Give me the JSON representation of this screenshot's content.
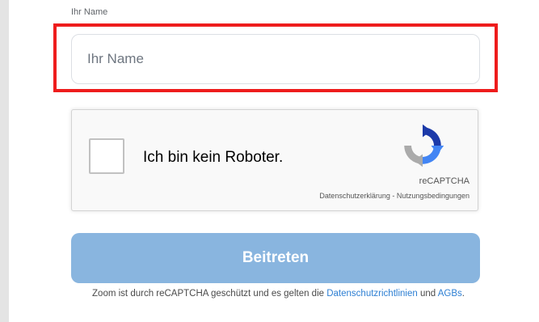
{
  "form": {
    "name_label": "Ihr Name",
    "name_input": {
      "value": "",
      "placeholder": "Ihr Name"
    },
    "highlight_color": "#ee1c1c"
  },
  "recaptcha": {
    "checkbox_label": "Ich bin kein Roboter.",
    "brand": "reCAPTCHA",
    "privacy_link": "Datenschutzerklärung",
    "separator": " - ",
    "terms_link": "Nutzungsbedingungen",
    "checked": false
  },
  "join_button": {
    "label": "Beitreten",
    "color": "#89b5df"
  },
  "footer": {
    "text_before": "Zoom ist durch reCAPTCHA geschützt und es gelten die ",
    "privacy_link": "Datenschutzrichtlinien",
    "text_middle": " und ",
    "terms_link": "AGBs",
    "text_end": ".",
    "link_color": "#2d7fd3"
  }
}
